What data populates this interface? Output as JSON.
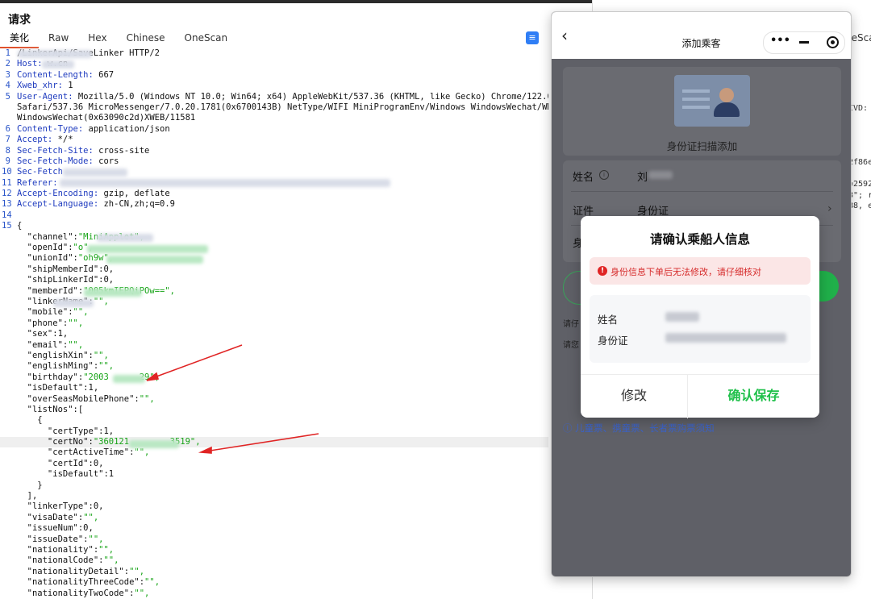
{
  "request": {
    "title": "请求",
    "tabs": [
      "美化",
      "Raw",
      "Hex",
      "Chinese",
      "OneScan"
    ],
    "lines": [
      {
        "n": "1",
        "t": "/LinkerApi/SaveLinker HTTP/2"
      },
      {
        "n": "2",
        "k": "Host:",
        "t": " w.cn"
      },
      {
        "n": "3",
        "k": "Content-Length:",
        "t": " 667"
      },
      {
        "n": "4",
        "k": "Xweb_xhr:",
        "t": " 1"
      },
      {
        "n": "5",
        "k": "User-Agent:",
        "t": " Mozilla/5.0 (Windows NT 10.0; Win64; x64) AppleWebKit/537.36 (KHTML, like Gecko) Chrome/122.0"
      },
      {
        "n": "",
        "t": "Safari/537.36 MicroMessenger/7.0.20.1781(0x6700143B) NetType/WIFI MiniProgramEnv/Windows WindowsWechat/WM"
      },
      {
        "n": "",
        "t": "WindowsWechat(0x63090c2d)XWEB/11581"
      },
      {
        "n": "6",
        "k": "Content-Type:",
        "t": " application/json"
      },
      {
        "n": "7",
        "k": "Accept:",
        "t": " */*"
      },
      {
        "n": "8",
        "k": "Sec-Fetch-Site:",
        "t": " cross-site"
      },
      {
        "n": "9",
        "k": "Sec-Fetch-Mode:",
        "t": " cors"
      },
      {
        "n": "10",
        "k": "Sec-Fetch",
        "t": ""
      },
      {
        "n": "11",
        "k": "Referer:",
        "t": ""
      },
      {
        "n": "12",
        "k": "Accept-Encoding:",
        "t": " gzip, deflate"
      },
      {
        "n": "13",
        "k": "Accept-Language:",
        "t": " zh-CN,zh;q=0.9"
      },
      {
        "n": "14",
        "t": ""
      },
      {
        "n": "15",
        "t": "{"
      },
      {
        "n": "",
        "t": "  \"channel\":",
        "s": "\"MiniApplet\","
      },
      {
        "n": "",
        "t": "  \"openId\":",
        "s": "\"o\","
      },
      {
        "n": "",
        "t": "  \"unionId\":",
        "s": "\"oh9w\","
      },
      {
        "n": "",
        "t": "  \"shipMemberId\":0,"
      },
      {
        "n": "",
        "t": "  \"shipLinkerId\":0,"
      },
      {
        "n": "",
        "t": "  \"memberId\":",
        "s": "\"005kmIEPQiPOw==\","
      },
      {
        "n": "",
        "t": "  \"linkerName\":",
        "s": "\"\","
      },
      {
        "n": "",
        "t": "  \"mobile\":",
        "s": "\"\","
      },
      {
        "n": "",
        "t": "  \"phone\":",
        "s": "\"\","
      },
      {
        "n": "",
        "t": "  \"sex\":1,"
      },
      {
        "n": "",
        "t": "  \"email\":",
        "s": "\"\","
      },
      {
        "n": "",
        "t": "  \"englishXin\":",
        "s": "\"\","
      },
      {
        "n": "",
        "t": "  \"englishMing\":",
        "s": "\"\","
      },
      {
        "n": "",
        "t": "  \"birthday\":",
        "s": "\"2003      29\","
      },
      {
        "n": "",
        "t": "  \"isDefault\":1,"
      },
      {
        "n": "",
        "t": "  \"overSeasMobilePhone\":",
        "s": "\"\","
      },
      {
        "n": "",
        "t": "  \"listNos\":["
      },
      {
        "n": "",
        "t": "    {"
      },
      {
        "n": "",
        "t": "      \"certType\":1,"
      },
      {
        "n": "",
        "t": "      \"certNo\":",
        "s": "\"360121        3519\","
      },
      {
        "n": "",
        "t": "      \"certActiveTime\":",
        "s": "\"\","
      },
      {
        "n": "",
        "t": "      \"certId\":0,"
      },
      {
        "n": "",
        "t": "      \"isDefault\":1"
      },
      {
        "n": "",
        "t": "    }"
      },
      {
        "n": "",
        "t": "  ],"
      },
      {
        "n": "",
        "t": "  \"linkerType\":0,"
      },
      {
        "n": "",
        "t": "  \"visaDate\":",
        "s": "\"\","
      },
      {
        "n": "",
        "t": "  \"issueNum\":0,"
      },
      {
        "n": "",
        "t": "  \"issueDate\":",
        "s": "\"\","
      },
      {
        "n": "",
        "t": "  \"nationality\":",
        "s": "\"\","
      },
      {
        "n": "",
        "t": "  \"nationalCode\":",
        "s": "\"\","
      },
      {
        "n": "",
        "t": "  \"nationalityDetail\":",
        "s": "\"\","
      },
      {
        "n": "",
        "t": "  \"nationalityThreeCode\":",
        "s": "\"\","
      },
      {
        "n": "",
        "t": "  \"nationalityTwoCode\":",
        "s": "\"\","
      }
    ]
  },
  "right_pane": {
    "tab_fragment": "neSca",
    "fragments": [
      "IVD:",
      "2f86e",
      "=2592",
      "3\"; r",
      "88, e"
    ]
  },
  "miniapp": {
    "title": "添加乘客",
    "scan_label": "身份证扫描添加",
    "fields": {
      "name_label": "姓名",
      "name_value": "刘",
      "cert_label": "证件",
      "cert_value": "身份证",
      "third_label": "身"
    },
    "notes": [
      "请仔",
      "请您"
    ],
    "link": "儿童票、携童票、长者票购票须知"
  },
  "modal": {
    "title": "请确认乘船人信息",
    "warning": "身份信息下单后无法修改，请仔细核对",
    "name_label": "姓名",
    "id_label": "身份证",
    "edit_button": "修改",
    "save_button": "确认保存"
  },
  "colors": {
    "accent_tab": "#e0522d",
    "json_key": "#1e3bbf",
    "json_string": "#15a315",
    "save_green": "#1fc04a",
    "warning_red": "#d62b2b",
    "annotation_arrow": "#e02424"
  }
}
